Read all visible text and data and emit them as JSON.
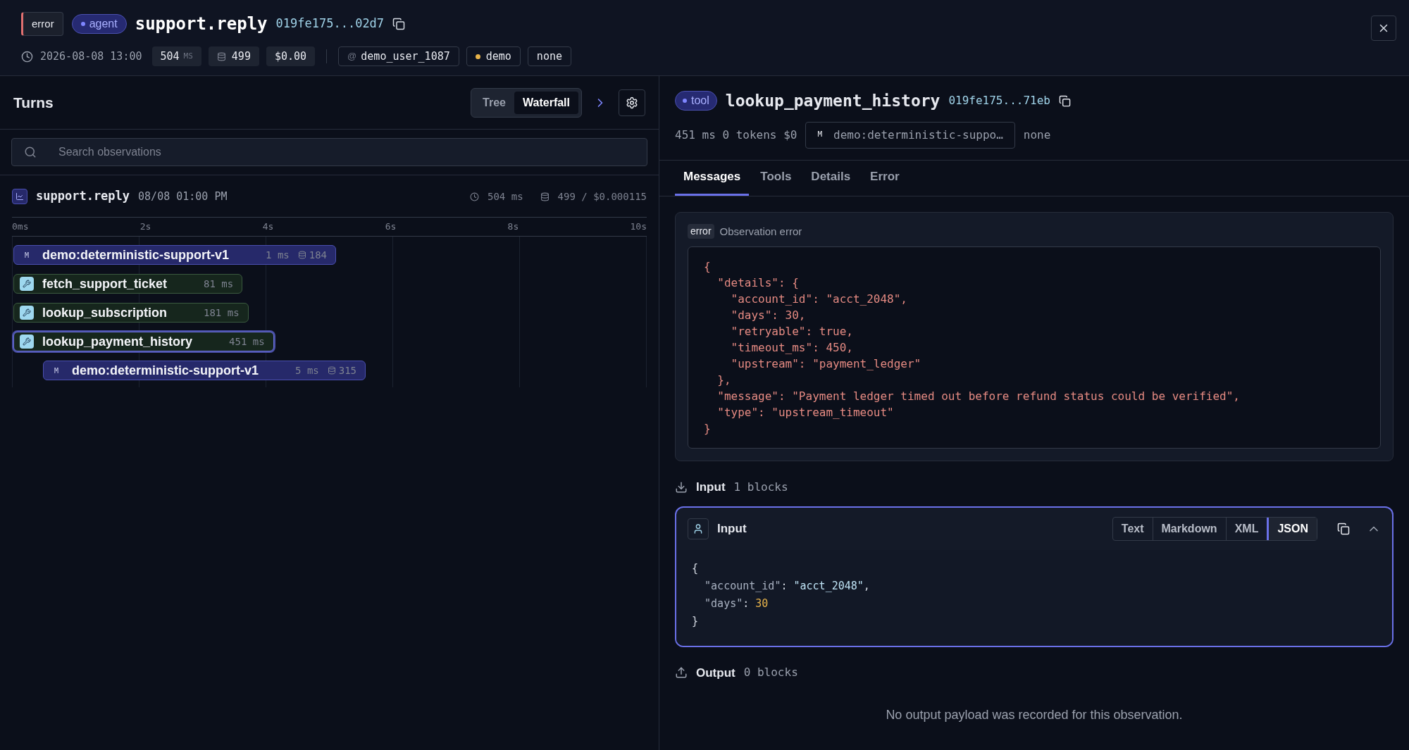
{
  "header": {
    "status": "error",
    "type": "agent",
    "title": "support.reply",
    "id": "019fe175...02d7",
    "timestamp": "2026-08-08 13:00",
    "latency": "504",
    "latency_unit": "MS",
    "tokens": "499",
    "cost": "$0.00",
    "user_prefix": "@",
    "user": "demo_user_1087",
    "environment": {
      "label": "demo",
      "color": "#e8b34a"
    },
    "release": "none"
  },
  "left": {
    "title": "Turns",
    "view_tabs": [
      {
        "label": "Tree",
        "selected": false
      },
      {
        "label": "Waterfall",
        "selected": true
      }
    ],
    "search": {
      "placeholder": "Search observations"
    },
    "trace": {
      "name": "support.reply",
      "time": "08/08 01:00 PM",
      "latency": "504 ms",
      "usage": "499 / $0.000115"
    },
    "axis": [
      "0ms",
      "2s",
      "4s",
      "6s",
      "8s",
      "10s"
    ],
    "spans": [
      {
        "kind": "generation",
        "badge": "M",
        "name": "demo:deterministic-support-v1",
        "latency": "1 ms",
        "tokens": "184",
        "selected": false
      },
      {
        "kind": "tool",
        "name": "fetch_support_ticket",
        "latency": "81 ms",
        "selected": false
      },
      {
        "kind": "tool",
        "name": "lookup_subscription",
        "latency": "181 ms",
        "selected": false
      },
      {
        "kind": "tool",
        "name": "lookup_payment_history",
        "latency": "451 ms",
        "selected": true,
        "children": [
          {
            "kind": "generation",
            "badge": "M",
            "name": "demo:deterministic-support-v1",
            "latency": "5 ms",
            "tokens": "315",
            "selected": false
          }
        ]
      }
    ]
  },
  "right": {
    "type": "tool",
    "title": "lookup_payment_history",
    "id": "019fe175...71eb",
    "stats": "451 ms 0 tokens $0",
    "model_badge": "M",
    "model": "demo:deterministic-suppo…",
    "release": "none",
    "tabs": [
      {
        "label": "Messages",
        "selected": true
      },
      {
        "label": "Tools",
        "selected": false
      },
      {
        "label": "Details",
        "selected": false
      },
      {
        "label": "Error",
        "selected": false
      }
    ],
    "error": {
      "badge": "error",
      "title": "Observation error",
      "lines": [
        "{",
        "  \"details\": {",
        "    \"account_id\": \"acct_2048\",",
        "    \"days\": 30,",
        "    \"retryable\": true,",
        "    \"timeout_ms\": 450,",
        "    \"upstream\": \"payment_ledger\"",
        "  },",
        "  \"message\": \"Payment ledger timed out before refund status could be verified\",",
        "  \"type\": \"upstream_timeout\"",
        "}"
      ]
    },
    "input_section": {
      "label": "Input",
      "count": "1 blocks"
    },
    "input_block": {
      "title": "Input",
      "formats": [
        {
          "label": "Text",
          "selected": false
        },
        {
          "label": "Markdown",
          "selected": false
        },
        {
          "label": "XML",
          "selected": false
        },
        {
          "label": "JSON",
          "selected": true
        }
      ],
      "lines": [
        [
          {
            "kind": "punct",
            "text": "{"
          }
        ],
        [
          {
            "kind": "key",
            "text": "  \"account_id\""
          },
          {
            "kind": "punct",
            "text": ": "
          },
          {
            "kind": "string",
            "text": "\"acct_2048\""
          },
          {
            "kind": "punct",
            "text": ","
          }
        ],
        [
          {
            "kind": "key",
            "text": "  \"days\""
          },
          {
            "kind": "punct",
            "text": ": "
          },
          {
            "kind": "number",
            "text": "30"
          }
        ],
        [
          {
            "kind": "punct",
            "text": "}"
          }
        ]
      ]
    },
    "output_section": {
      "label": "Output",
      "count": "0 blocks",
      "empty": "No output payload was recorded for this observation."
    }
  }
}
